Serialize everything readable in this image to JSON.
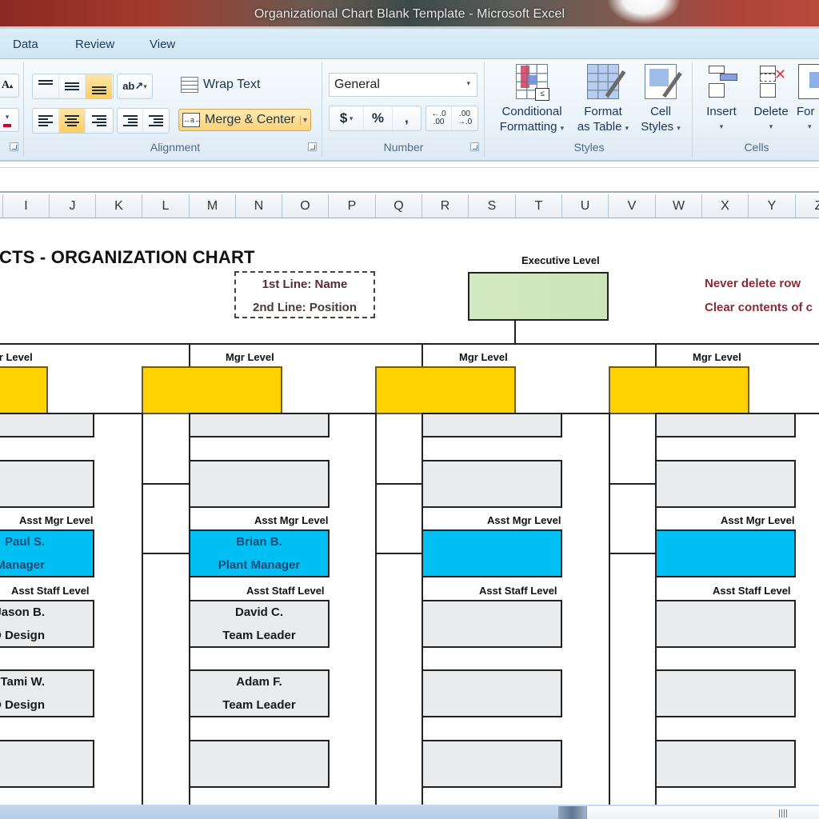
{
  "window": {
    "title": "Organizational Chart Blank Template - Microsoft Excel"
  },
  "ribbon": {
    "tabs": [
      {
        "label": "Data"
      },
      {
        "label": "Review"
      },
      {
        "label": "View"
      }
    ],
    "groups": {
      "alignment": {
        "label": "Alignment",
        "wrap_text": "Wrap Text",
        "merge_center": "Merge & Center",
        "vertical_align_active": "bottom",
        "horizontal_align_active": "center"
      },
      "number": {
        "label": "Number",
        "format_value": "General",
        "currency_symbol": "$",
        "percent_symbol": "%",
        "comma_symbol": ",",
        "increase_decimal": "←.0 .00",
        "decrease_decimal": ".00 →.0"
      },
      "styles": {
        "label": "Styles",
        "conditional_formatting": [
          "Conditional",
          "Formatting"
        ],
        "format_as_table": [
          "Format",
          "as Table"
        ],
        "cell_styles": [
          "Cell",
          "Styles"
        ]
      },
      "cells": {
        "label": "Cells",
        "insert": "Insert",
        "delete": "Delete",
        "format": "For"
      }
    }
  },
  "columns": [
    "I",
    "J",
    "K",
    "L",
    "M",
    "N",
    "O",
    "P",
    "Q",
    "R",
    "S",
    "T",
    "U",
    "V",
    "W",
    "X",
    "Y",
    "Z"
  ],
  "sheet": {
    "title": "CTS - ORGANIZATION CHART",
    "legend": {
      "line1": "1st Line: Name",
      "line2": "2nd Line: Position"
    },
    "notes": [
      {
        "text": "Never delete row",
        "color": "#8b2a35"
      },
      {
        "text": "Clear contents of c",
        "color": "#8b2a35"
      }
    ],
    "colors": {
      "executive": "#cfe6bb",
      "manager": "#ffd200",
      "asst_manager": "#00bff3",
      "staff": "#e9ebec",
      "asst_manager_text": "#1f4a78"
    },
    "levels": {
      "executive": "Executive Level",
      "manager": "Mgr Level",
      "asst_manager": "Asst Mgr Level",
      "asst_staff": "Asst Staff Level"
    },
    "executive": {
      "name": "",
      "position": ""
    },
    "branches": [
      {
        "manager": {
          "name": "",
          "position": ""
        },
        "asst_manager": {
          "name": "Paul S.",
          "position": "CAD Manager"
        },
        "staff": [
          {
            "name": "Jason B.",
            "position": "CAD Design"
          },
          {
            "name": "Tami W.",
            "position": "CAD Design"
          },
          {
            "name": "",
            "position": ""
          }
        ]
      },
      {
        "manager": {
          "name": "",
          "position": ""
        },
        "asst_manager": {
          "name": "Brian B.",
          "position": "Plant Manager"
        },
        "staff": [
          {
            "name": "David C.",
            "position": "Team Leader"
          },
          {
            "name": "Adam F.",
            "position": "Team Leader"
          },
          {
            "name": "",
            "position": ""
          }
        ]
      },
      {
        "manager": {
          "name": "",
          "position": ""
        },
        "asst_manager": {
          "name": "",
          "position": ""
        },
        "staff": [
          {
            "name": "",
            "position": ""
          },
          {
            "name": "",
            "position": ""
          },
          {
            "name": "",
            "position": ""
          }
        ]
      },
      {
        "manager": {
          "name": "",
          "position": ""
        },
        "asst_manager": {
          "name": "",
          "position": ""
        },
        "staff": [
          {
            "name": "",
            "position": ""
          },
          {
            "name": "",
            "position": ""
          },
          {
            "name": "",
            "position": ""
          }
        ]
      }
    ]
  }
}
